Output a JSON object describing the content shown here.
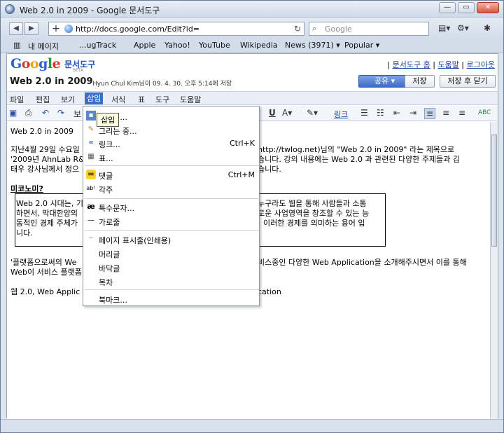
{
  "window": {
    "title": "Web 2.0 in 2009 - Google 문서도구"
  },
  "browser": {
    "url": "http://docs.google.com/Edit?id=",
    "search_placeholder": "Google",
    "bookmarks": [
      "내 페이지",
      "...ugTrack",
      "Apple",
      "Yahoo!",
      "YouTube",
      "Wikipedia",
      "News (3971) ▾",
      "Popular ▾"
    ]
  },
  "header": {
    "logo_suffix": "문서도구",
    "beta": "BETA",
    "links": [
      "문서도구 홈",
      "도움말",
      "로그아웃"
    ],
    "doc_title": "Web 2.0 in 2009",
    "save_meta": "Hyun Chul Kim님이 09. 4. 30. 오후 5:14에 저장",
    "share": "공유 ▾",
    "save": "저장",
    "save_close": "저장 후 닫기"
  },
  "menubar": [
    "파일",
    "편집",
    "보기",
    "삽입",
    "서식",
    "표",
    "도구",
    "도움말"
  ],
  "toolbar": {
    "font_label": "보",
    "link_label": "링크"
  },
  "tooltip": "삽입",
  "insert_menu": [
    {
      "icon": "image-icon",
      "label": "이미지..."
    },
    {
      "icon": "drawing-icon",
      "label": "그리는 중..."
    },
    {
      "icon": "link-icon",
      "label": "링크...",
      "shortcut": "Ctrl+K"
    },
    {
      "icon": "table-icon",
      "label": "표..."
    },
    {
      "icon": "comment-icon",
      "label": "댓글",
      "shortcut": "Ctrl+M"
    },
    {
      "icon": "footnote-icon",
      "label": "각주"
    },
    {
      "icon": "special-char-icon",
      "label": "특수문자..."
    },
    {
      "icon": "hrule-icon",
      "label": "가로줄"
    },
    {
      "icon": "pagebreak-icon",
      "label": "페이지 표시줄(인쇄용)"
    },
    {
      "icon": "",
      "label": "머리글"
    },
    {
      "icon": "",
      "label": "바닥글"
    },
    {
      "icon": "",
      "label": "목차"
    },
    {
      "icon": "",
      "label": "북마크..."
    }
  ],
  "document": {
    "heading": "Web 2.0 in 2009",
    "para1_a": "지난4월 29일 수요일",
    "para1_a2": "http://twlog.net)님의 \"Web 2.0 in 2009\" 라는 제목으로",
    "para1_b": "'2009년 AhnLab R&",
    "para1_b2": "습니다. 강의 내용에는 Web 2.0 과 관련된 다양한 주제들과 김",
    "para1_c": "태우 강사님께서 정으",
    "para1_c2": "습니다.",
    "subheading": "미코노미?",
    "box_a": "Web 2.0 시대는, 기",
    "box_a2": "누구라도 웹을 통해 사람들과 소통",
    "box_b": "하면서, 막대한양의",
    "box_b2": "로운 사업영역을 창조할 수 있는 능",
    "box_c": "동적인 경제 주체가",
    "box_c2": "이러한 경제를 의미하는 용어 입",
    "box_d": "니다.",
    "para2_a": "'플랫폼으로써의 We",
    "para2_a2": "비스중인 다양한 Web Application을 소개해주시면서 이를 통해",
    "para2_b": "Web이 서비스 플랫폼",
    "para3_a": "웹 2.0, Web Applic",
    "para3_a2": "cation"
  }
}
